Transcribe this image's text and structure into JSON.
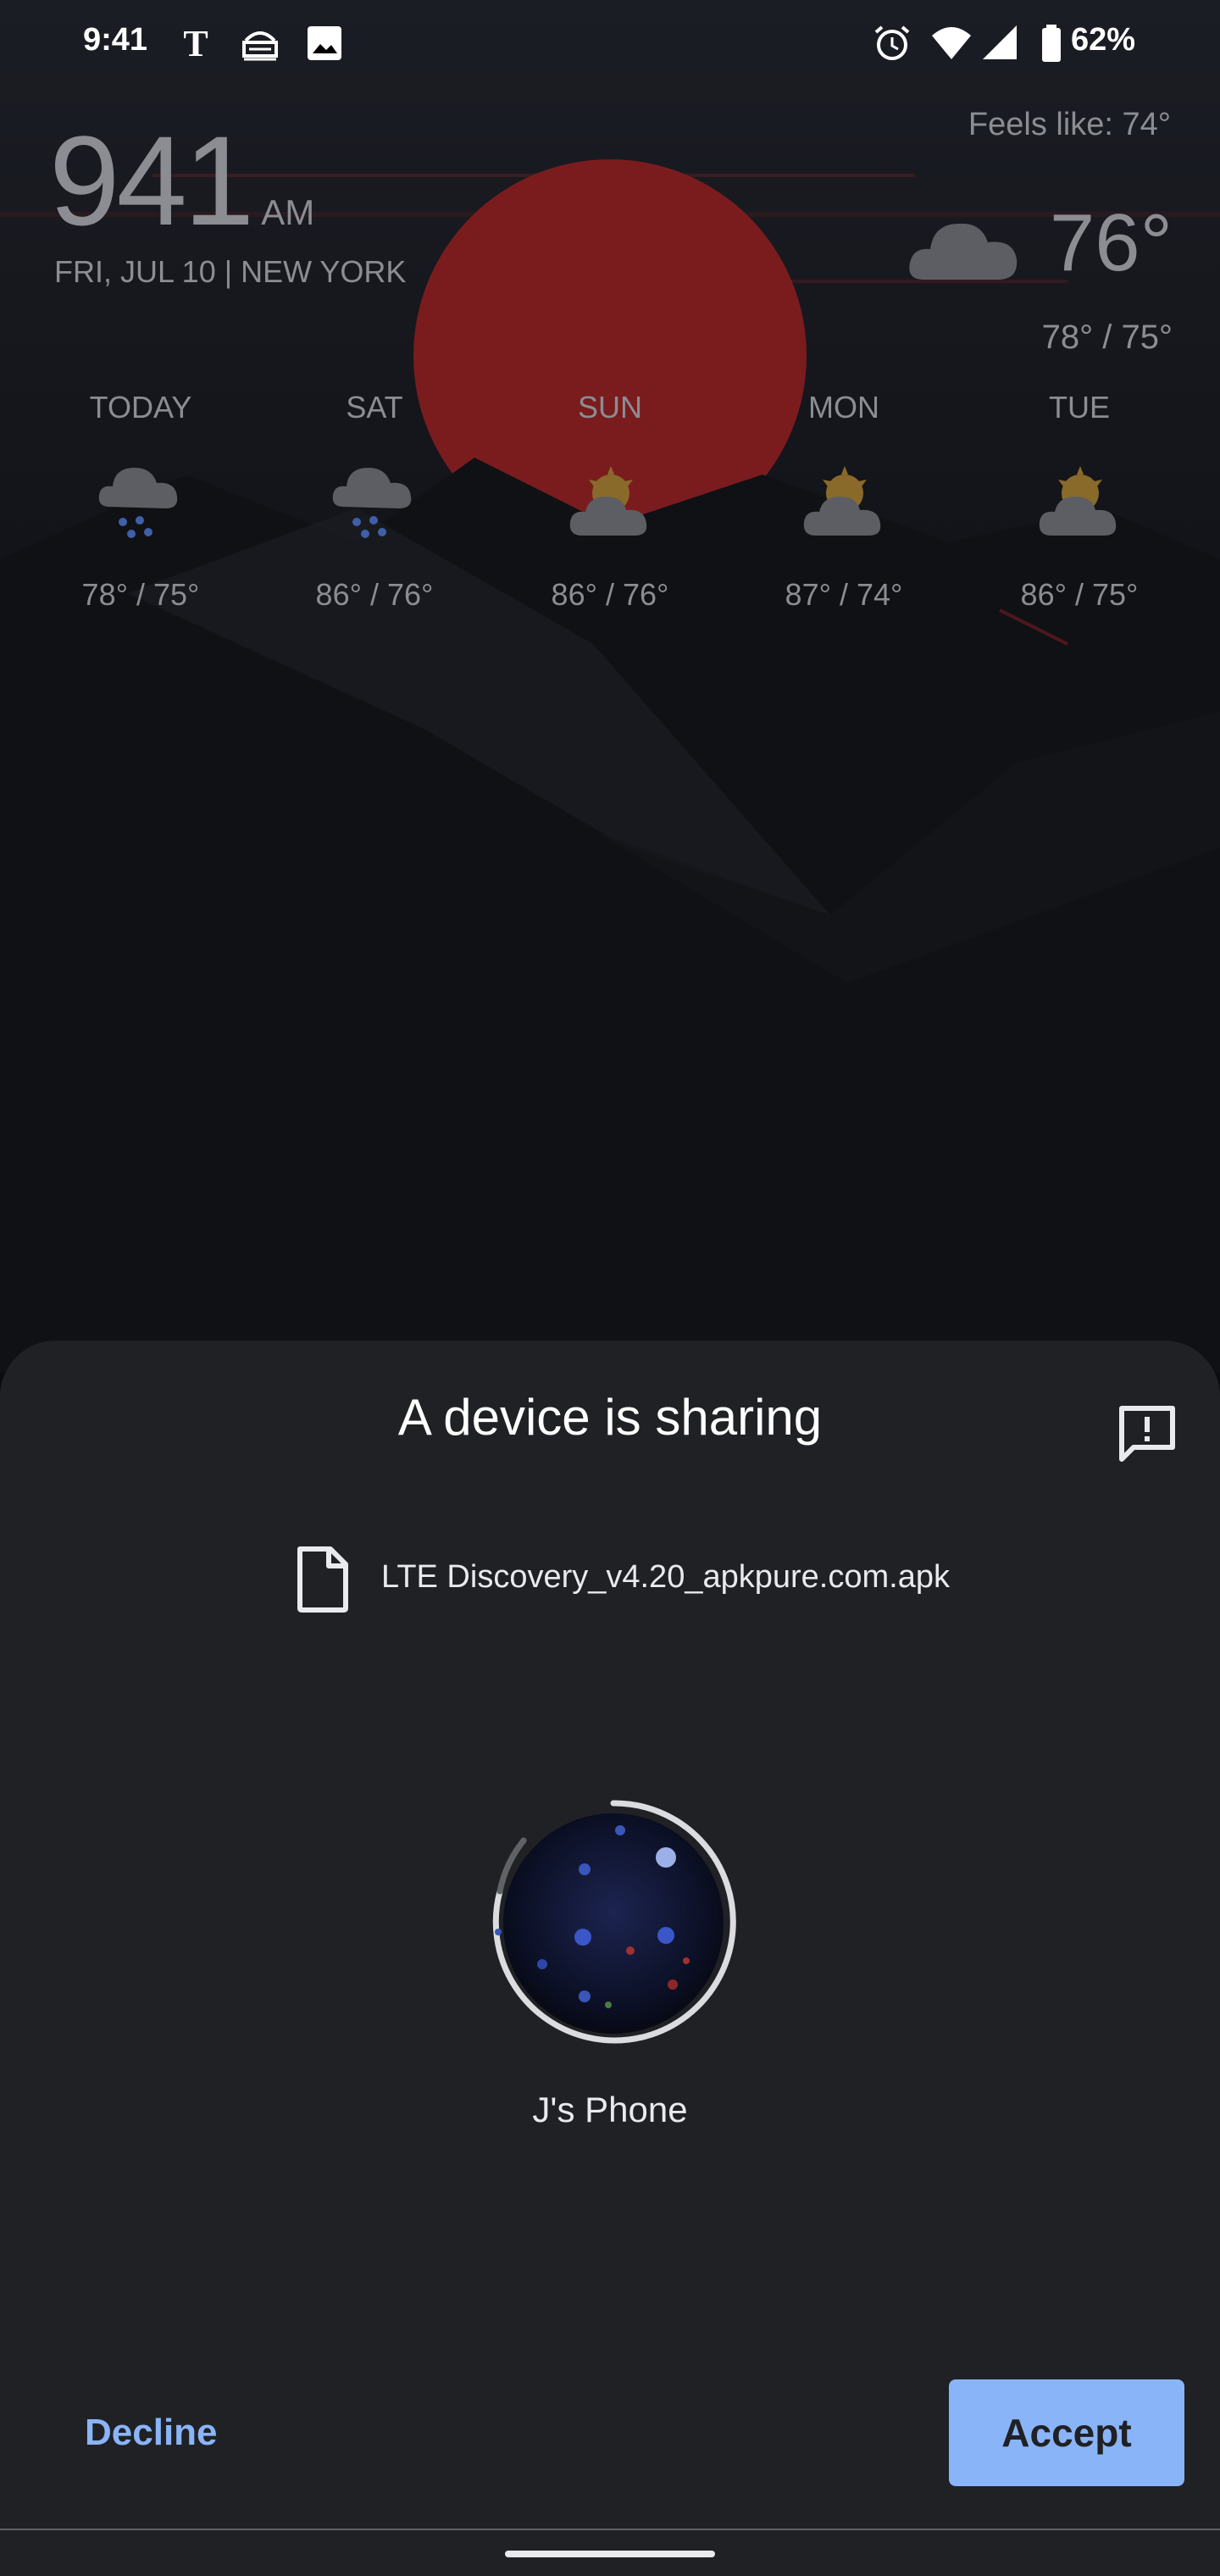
{
  "status_bar": {
    "time": "9:41",
    "battery": "62%",
    "icons": [
      "nyt-icon",
      "tv-icon",
      "image-icon",
      "alarm-icon",
      "wifi-icon",
      "signal-icon",
      "battery-icon"
    ]
  },
  "widget": {
    "clock_time": "941",
    "clock_ampm": "AM",
    "date_location": "FRI, JUL 10 | NEW YORK",
    "feels_like": "Feels like: 74°",
    "current_temp": "76°",
    "current_range": "78° / 75°",
    "forecast": [
      {
        "day": "TODAY",
        "temp": "78° / 75°",
        "icon": "rain-cloud-icon"
      },
      {
        "day": "SAT",
        "temp": "86° / 76°",
        "icon": "rain-cloud-icon"
      },
      {
        "day": "SUN",
        "temp": "86° / 76°",
        "icon": "partly-cloudy-icon"
      },
      {
        "day": "MON",
        "temp": "87° / 74°",
        "icon": "partly-cloudy-icon"
      },
      {
        "day": "TUE",
        "temp": "86° / 75°",
        "icon": "partly-cloudy-icon"
      }
    ]
  },
  "share_sheet": {
    "title": "A device is sharing",
    "file_name": "LTE Discovery_v4.20_apkpure.com.apk",
    "device_name": "J's Phone",
    "decline_label": "Decline",
    "accept_label": "Accept"
  },
  "colors": {
    "accent": "#8ab4f8",
    "sheet_bg": "#202125",
    "wallpaper_sun": "#7a1c1e"
  }
}
